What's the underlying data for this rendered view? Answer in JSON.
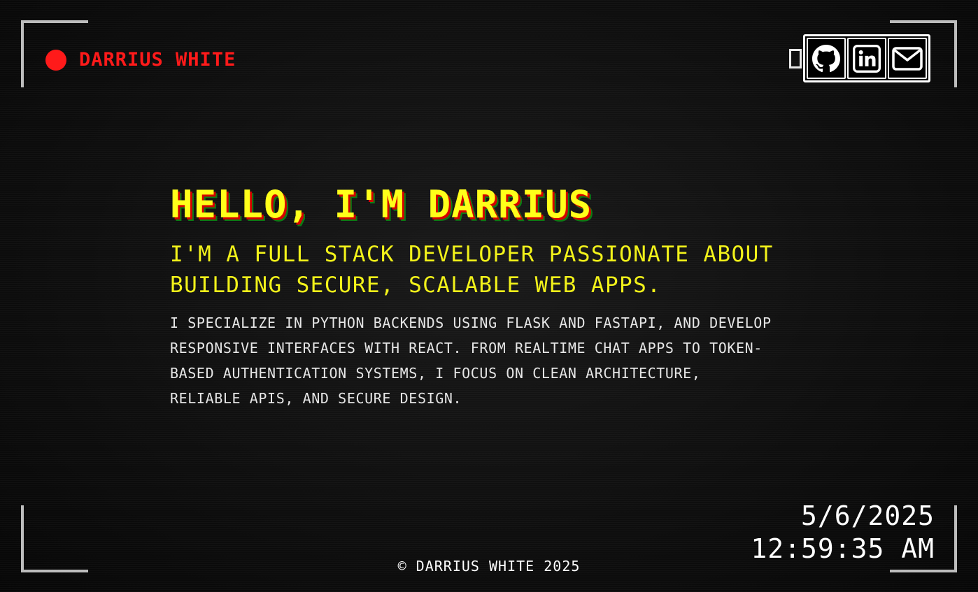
{
  "header": {
    "name": "DARRIUS WHITE"
  },
  "social": {
    "links": [
      {
        "icon": "github-icon"
      },
      {
        "icon": "linkedin-icon"
      },
      {
        "icon": "mail-icon"
      }
    ]
  },
  "hero": {
    "title": "HELLO, I'M DARRIUS",
    "subtitle": "I'M A FULL STACK DEVELOPER PASSIONATE ABOUT BUILDING SECURE, SCALABLE WEB APPS.",
    "body": "I specialize in Python backends using Flask and FastAPI, and develop responsive interfaces with React. From realtime chat apps to token-based authentication systems, I focus on clean architecture, reliable APIs, and secure design."
  },
  "timestamp": {
    "date": "5/6/2025",
    "time": "12:59:35 AM"
  },
  "footer": {
    "copyright": "© DARRIUS WHITE 2025"
  },
  "colors": {
    "record": "#ff1a1a",
    "accent_yellow": "#ffff1a",
    "shadow_red": "#d40000",
    "shadow_green": "#0a7d14",
    "text": "#e6e6e6"
  }
}
